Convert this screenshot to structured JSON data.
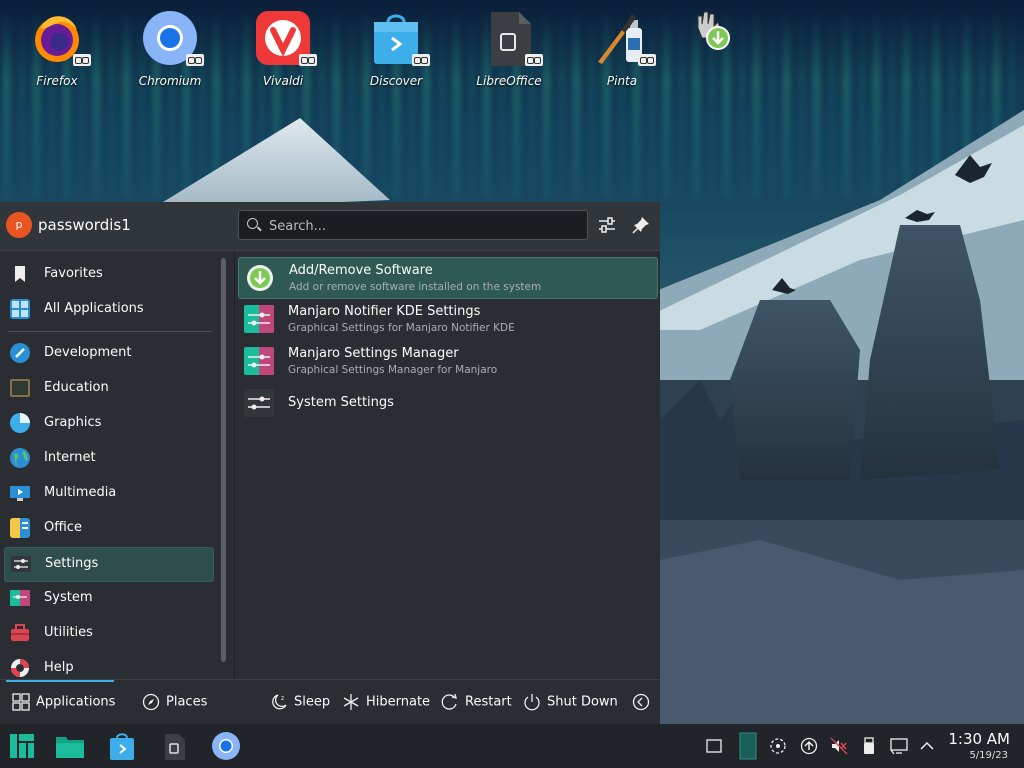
{
  "desktop": {
    "icons": [
      {
        "label": "Firefox"
      },
      {
        "label": "Chromium"
      },
      {
        "label": "Vivaldi"
      },
      {
        "label": "Discover"
      },
      {
        "label": "LibreOffice"
      },
      {
        "label": "Pinta"
      }
    ]
  },
  "launcher": {
    "user": {
      "initial": "p",
      "name": "passwordis1"
    },
    "search": {
      "placeholder": "Search..."
    },
    "categories": [
      {
        "label": "Favorites"
      },
      {
        "label": "All Applications"
      },
      {
        "label": "Development"
      },
      {
        "label": "Education"
      },
      {
        "label": "Graphics"
      },
      {
        "label": "Internet"
      },
      {
        "label": "Multimedia"
      },
      {
        "label": "Office"
      },
      {
        "label": "Settings"
      },
      {
        "label": "System"
      },
      {
        "label": "Utilities"
      },
      {
        "label": "Help"
      }
    ],
    "apps": [
      {
        "name": "Add/Remove Software",
        "desc": "Add or remove software installed on the system"
      },
      {
        "name": "Manjaro Notifier KDE Settings",
        "desc": "Graphical Settings for Manjaro Notifier KDE"
      },
      {
        "name": "Manjaro Settings Manager",
        "desc": "Graphical Settings Manager for Manjaro"
      },
      {
        "name": "System Settings",
        "desc": ""
      }
    ],
    "footer": {
      "applications": "Applications",
      "places": "Places",
      "sleep": "Sleep",
      "hibernate": "Hibernate",
      "restart": "Restart",
      "shutdown": "Shut Down"
    }
  },
  "taskbar": {
    "clock": {
      "time": "1:30 AM",
      "date": "5/19/23"
    }
  },
  "colors": {
    "accent": "#3daee9",
    "selection": "#2e5a52",
    "panel": "#2a2e32"
  }
}
